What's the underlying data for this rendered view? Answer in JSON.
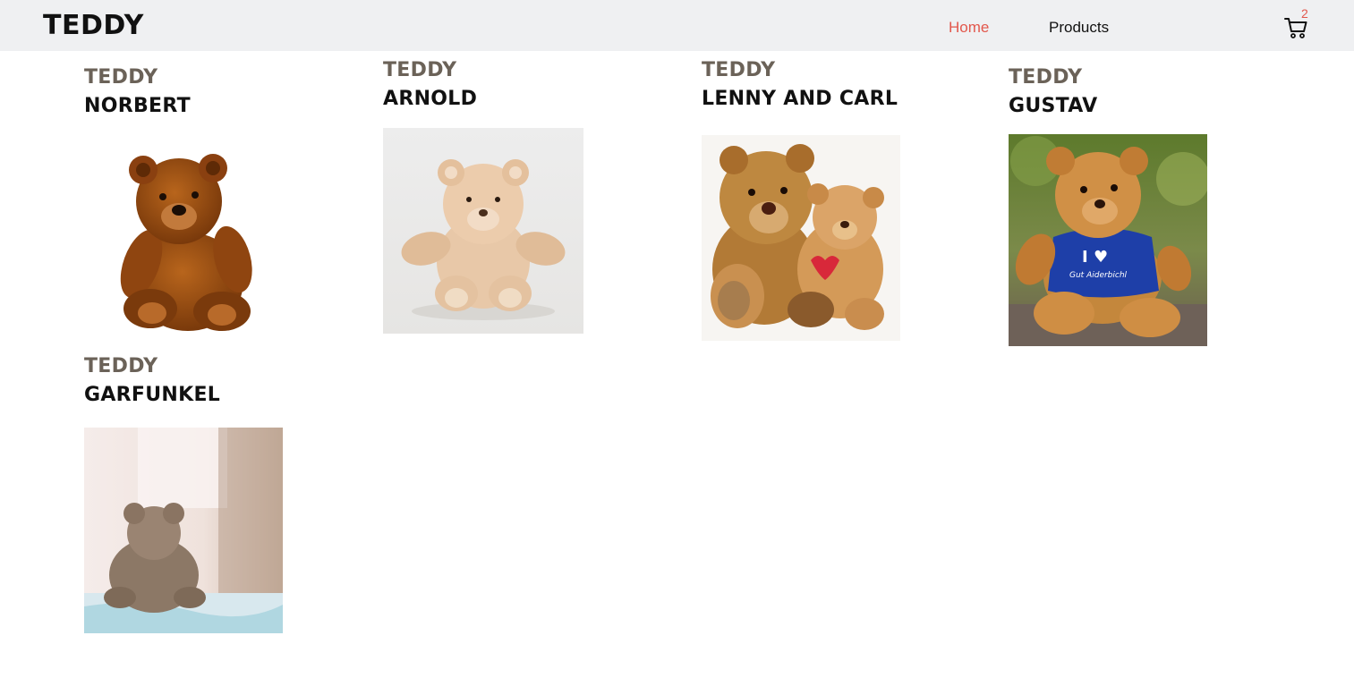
{
  "header": {
    "brand": "TEDDY",
    "nav": [
      {
        "label": "Home",
        "active": true
      },
      {
        "label": "Products",
        "active": false
      }
    ],
    "cart_count": "2",
    "active_color": "#e2574c"
  },
  "products": [
    {
      "kicker": "TEDDY",
      "name": "NORBERT",
      "image": "brown-teddy-bear"
    },
    {
      "kicker": "TEDDY",
      "name": "ARNOLD",
      "image": "beige-teddy-bear"
    },
    {
      "kicker": "TEDDY",
      "name": "LENNY AND CARL",
      "image": "two-teddy-bears"
    },
    {
      "kicker": "TEDDY",
      "name": "GUSTAV",
      "image": "teddy-bear-blue-shirt",
      "shirt_text": "I ♥",
      "shirt_subtext": "Gut Aiderbichl"
    },
    {
      "kicker": "TEDDY",
      "name": "GARFUNKEL",
      "image": "teddy-bear-back-view"
    }
  ]
}
